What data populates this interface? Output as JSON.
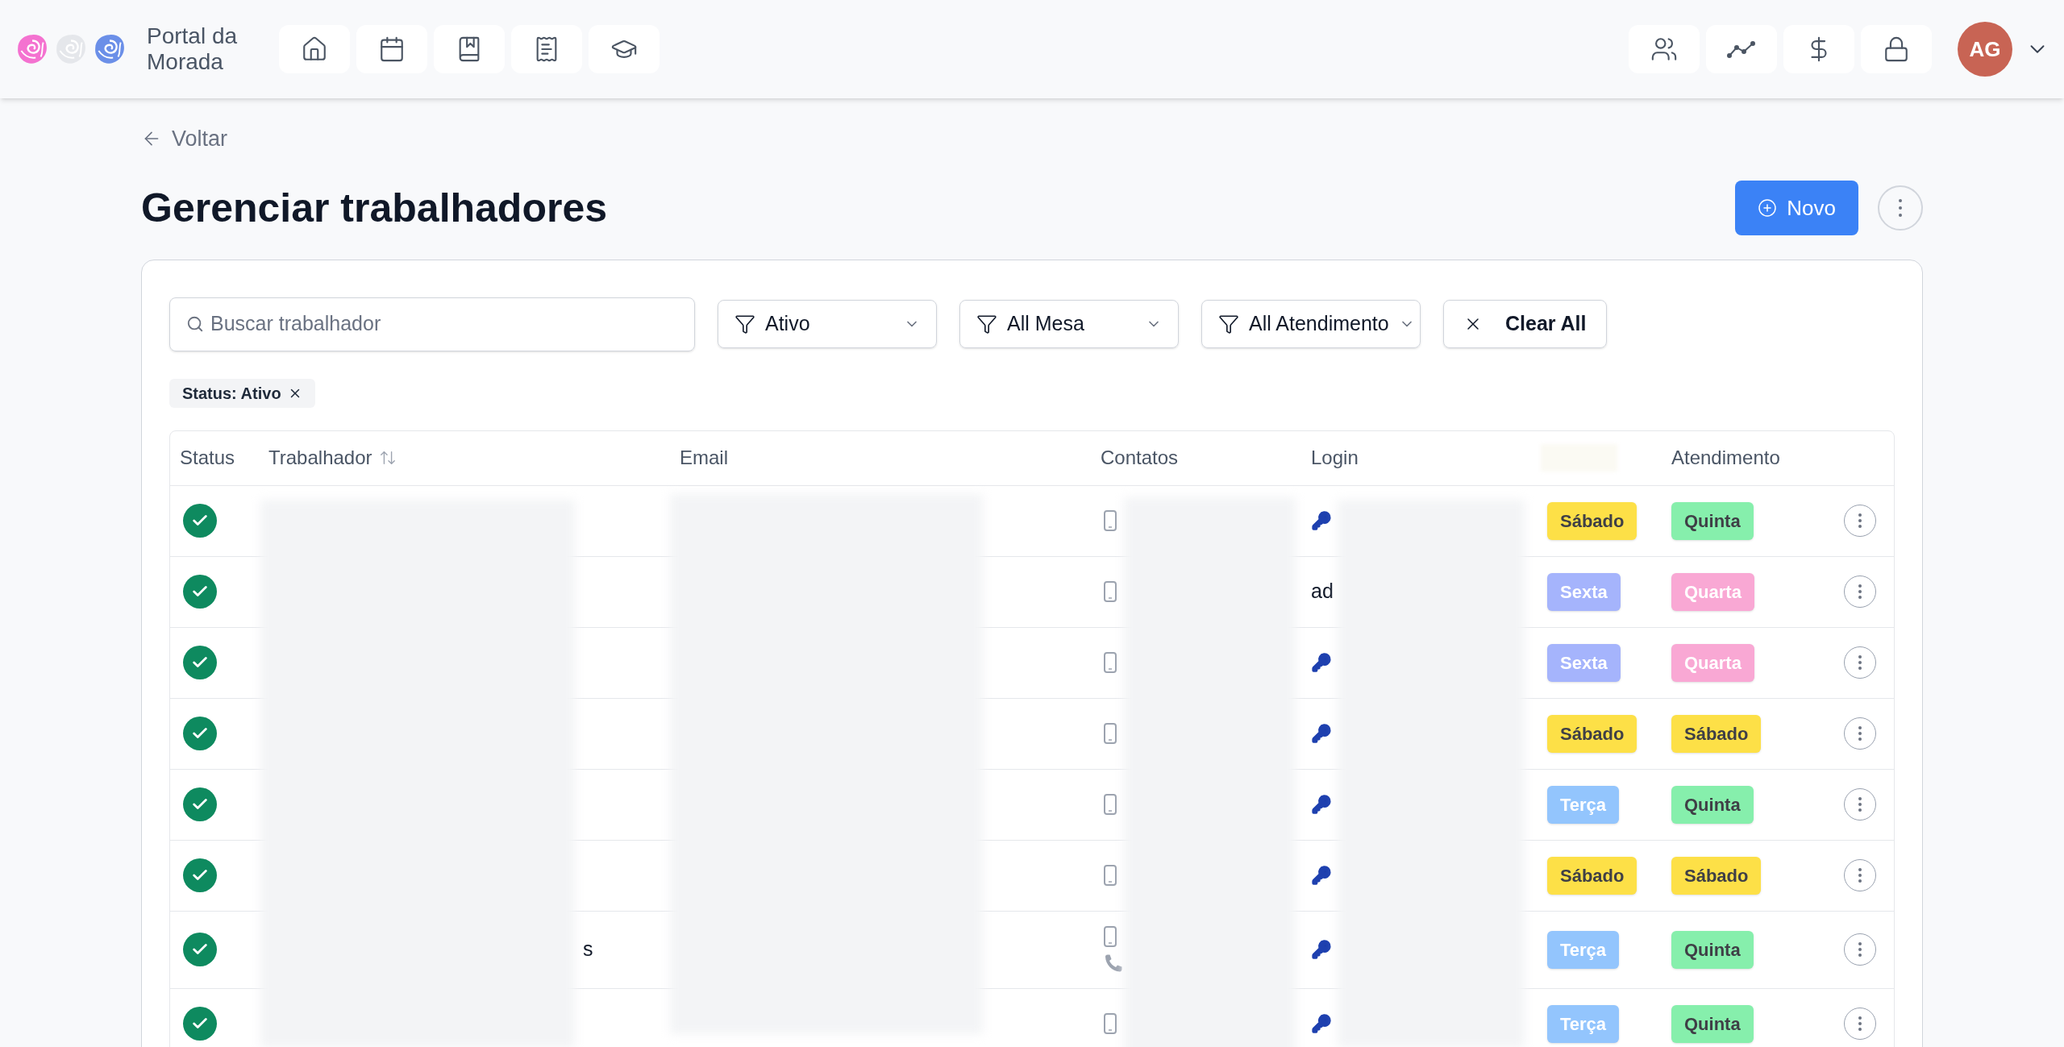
{
  "app": {
    "title": "Portal da Morada"
  },
  "user": {
    "initials": "AG"
  },
  "back": "Voltar",
  "page_title": "Gerenciar trabalhadores",
  "new_button": "Novo",
  "search": {
    "placeholder": "Buscar trabalhador"
  },
  "filters": [
    {
      "label": "Ativo"
    },
    {
      "label": "All Mesa"
    },
    {
      "label": "All Atendimento"
    }
  ],
  "clear_button": "Clear All",
  "chips": [
    {
      "label": "Status: Ativo"
    }
  ],
  "table": {
    "columns": [
      {
        "kind": "text",
        "label": "Status"
      },
      {
        "kind": "sortable",
        "label": "Trabalhador"
      },
      {
        "kind": "text",
        "label": "Email"
      },
      {
        "kind": "text",
        "label": "Contatos"
      },
      {
        "kind": "text",
        "label": "Login"
      },
      {
        "kind": "hidden"
      },
      {
        "kind": "text",
        "label": "Atendimento"
      },
      {
        "kind": "actions"
      }
    ],
    "rows": [
      {
        "active": true,
        "contacts": [
          {
            "kind": "mobile"
          }
        ],
        "login": {
          "kind": "key"
        },
        "mesa": {
          "label": "Sábado",
          "color": "#fde047",
          "kind": "dark"
        },
        "atendimento": {
          "label": "Quinta",
          "color": "#86efac",
          "kind": "dark"
        }
      },
      {
        "active": true,
        "contacts": [
          {
            "kind": "mobile"
          }
        ],
        "login": {
          "kind": "text",
          "text": "ad"
        },
        "mesa": {
          "label": "Sexta",
          "color": "#a5b4fc",
          "kind": "light"
        },
        "atendimento": {
          "label": "Quarta",
          "color": "#f9a8d4",
          "kind": "light"
        }
      },
      {
        "active": true,
        "contacts": [
          {
            "kind": "mobile"
          }
        ],
        "login": {
          "kind": "key"
        },
        "mesa": {
          "label": "Sexta",
          "color": "#a5b4fc",
          "kind": "light"
        },
        "atendimento": {
          "label": "Quarta",
          "color": "#f9a8d4",
          "kind": "light"
        }
      },
      {
        "active": true,
        "contacts": [
          {
            "kind": "mobile"
          }
        ],
        "login": {
          "kind": "key"
        },
        "mesa": {
          "label": "Sábado",
          "color": "#fde047",
          "kind": "dark"
        },
        "atendimento": {
          "label": "Sábado",
          "color": "#fde047",
          "kind": "dark"
        }
      },
      {
        "active": true,
        "contacts": [
          {
            "kind": "mobile"
          }
        ],
        "login": {
          "kind": "key"
        },
        "mesa": {
          "label": "Terça",
          "color": "#93c5fd",
          "kind": "light"
        },
        "atendimento": {
          "label": "Quinta",
          "color": "#86efac",
          "kind": "dark"
        }
      },
      {
        "active": true,
        "contacts": [
          {
            "kind": "mobile"
          }
        ],
        "login": {
          "kind": "key"
        },
        "mesa": {
          "label": "Sábado",
          "color": "#fde047",
          "kind": "dark"
        },
        "atendimento": {
          "label": "Sábado",
          "color": "#fde047",
          "kind": "dark"
        }
      },
      {
        "active": true,
        "name": "s",
        "contacts": [
          {
            "kind": "mobile"
          },
          {
            "kind": "phone"
          }
        ],
        "login": {
          "kind": "key"
        },
        "mesa": {
          "label": "Terça",
          "color": "#93c5fd",
          "kind": "light"
        },
        "atendimento": {
          "label": "Quinta",
          "color": "#86efac",
          "kind": "dark"
        }
      },
      {
        "active": true,
        "contacts": [
          {
            "kind": "mobile"
          }
        ],
        "login": {
          "kind": "key"
        },
        "mesa": {
          "label": "Terça",
          "color": "#93c5fd",
          "kind": "light"
        },
        "atendimento": {
          "label": "Quinta",
          "color": "#86efac",
          "kind": "dark"
        }
      }
    ]
  }
}
